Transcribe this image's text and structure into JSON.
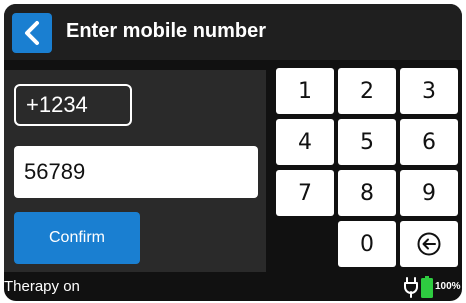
{
  "header": {
    "back_icon": "chevron-left-icon",
    "title": "Enter mobile number"
  },
  "form": {
    "country_code": "+1234",
    "number": "56789",
    "confirm_label": "Confirm"
  },
  "keypad": {
    "keys": [
      "1",
      "2",
      "3",
      "4",
      "5",
      "6",
      "7",
      "8",
      "9",
      "0"
    ],
    "backspace_icon": "backspace-arrow-icon"
  },
  "status": {
    "therapy_text": "Therapy on",
    "battery_percent": "100%",
    "plug_icon": "plug-icon",
    "battery_icon": "battery-icon"
  },
  "colors": {
    "accent": "#1a7fd1",
    "battery": "#2ecc40",
    "background": "#111111"
  }
}
